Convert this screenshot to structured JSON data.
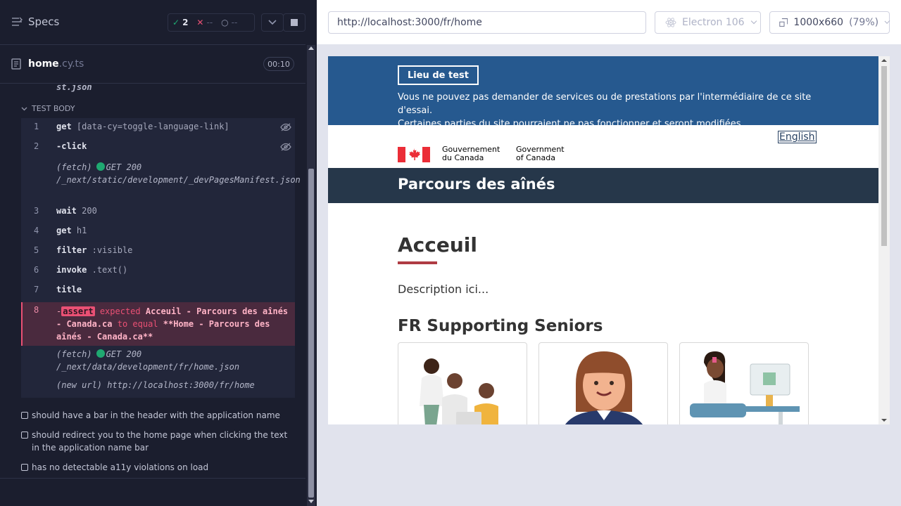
{
  "reporter": {
    "specs_label": "Specs",
    "stats": {
      "passed": "2",
      "failed": "--",
      "pending": "--"
    },
    "file": {
      "name": "home",
      "ext": ".cy.ts",
      "duration": "00:10"
    },
    "prev_line": "st.json",
    "test_body_label": "TEST BODY",
    "commands": [
      {
        "num": "1",
        "name": "get",
        "arg": "[data-cy=toggle-language-link]"
      },
      {
        "num": "2",
        "name": "-click",
        "arg": ""
      },
      {
        "num": "3",
        "name": "wait",
        "arg": "200"
      },
      {
        "num": "4",
        "name": "get",
        "arg": "h1"
      },
      {
        "num": "5",
        "name": "filter",
        "arg": ":visible"
      },
      {
        "num": "6",
        "name": "invoke",
        "arg": ".text()"
      },
      {
        "num": "7",
        "name": "title",
        "arg": ""
      }
    ],
    "fetch1": {
      "label": "(fetch)",
      "status": "GET 200",
      "path": "/_next/static/development/_devPagesManifest.json"
    },
    "fail": {
      "num": "8",
      "prefix": "-",
      "badge": "assert",
      "kw1": "expected",
      "actual": "Acceuil - Parcours des aînés - Canada.ca",
      "kw2": "to equal",
      "expected": "**Home - Parcours des aînés - Canada.ca**"
    },
    "fetch2": {
      "label": "(fetch)",
      "status": "GET 200",
      "path": "/_next/data/development/fr/home.json"
    },
    "new_url": {
      "label": "(new url)",
      "url": "http://localhost:3000/fr/home"
    },
    "tests": [
      "should have a bar in the header with the application name",
      "should redirect you to the home page when clicking the text in the application name bar",
      "has no detectable a11y violations on load"
    ]
  },
  "aut": {
    "url": "http://localhost:3000/fr/home",
    "browser": "Electron 106",
    "viewport": "1000x660",
    "zoom": "(79%)"
  },
  "app": {
    "banner_button": "Lieu de test",
    "banner_line1": "Vous ne pouvez pas demander de services ou de prestations par l'intermédiaire de ce site d'essai.",
    "banner_line2": "Certaines parties du site pourraient ne pas fonctionner et seront modifiées.",
    "language_link": "English",
    "gov_fr_1": "Gouvernement",
    "gov_fr_2": "du Canada",
    "gov_en_1": "Government",
    "gov_en_2": "of Canada",
    "app_name": "Parcours des aînés",
    "h1": "Acceuil",
    "description": "Description ici...",
    "h2": "FR Supporting Seniors",
    "accent_red": "#af3c43",
    "banner_blue": "#26598f",
    "appbar_navy": "#26374a"
  }
}
